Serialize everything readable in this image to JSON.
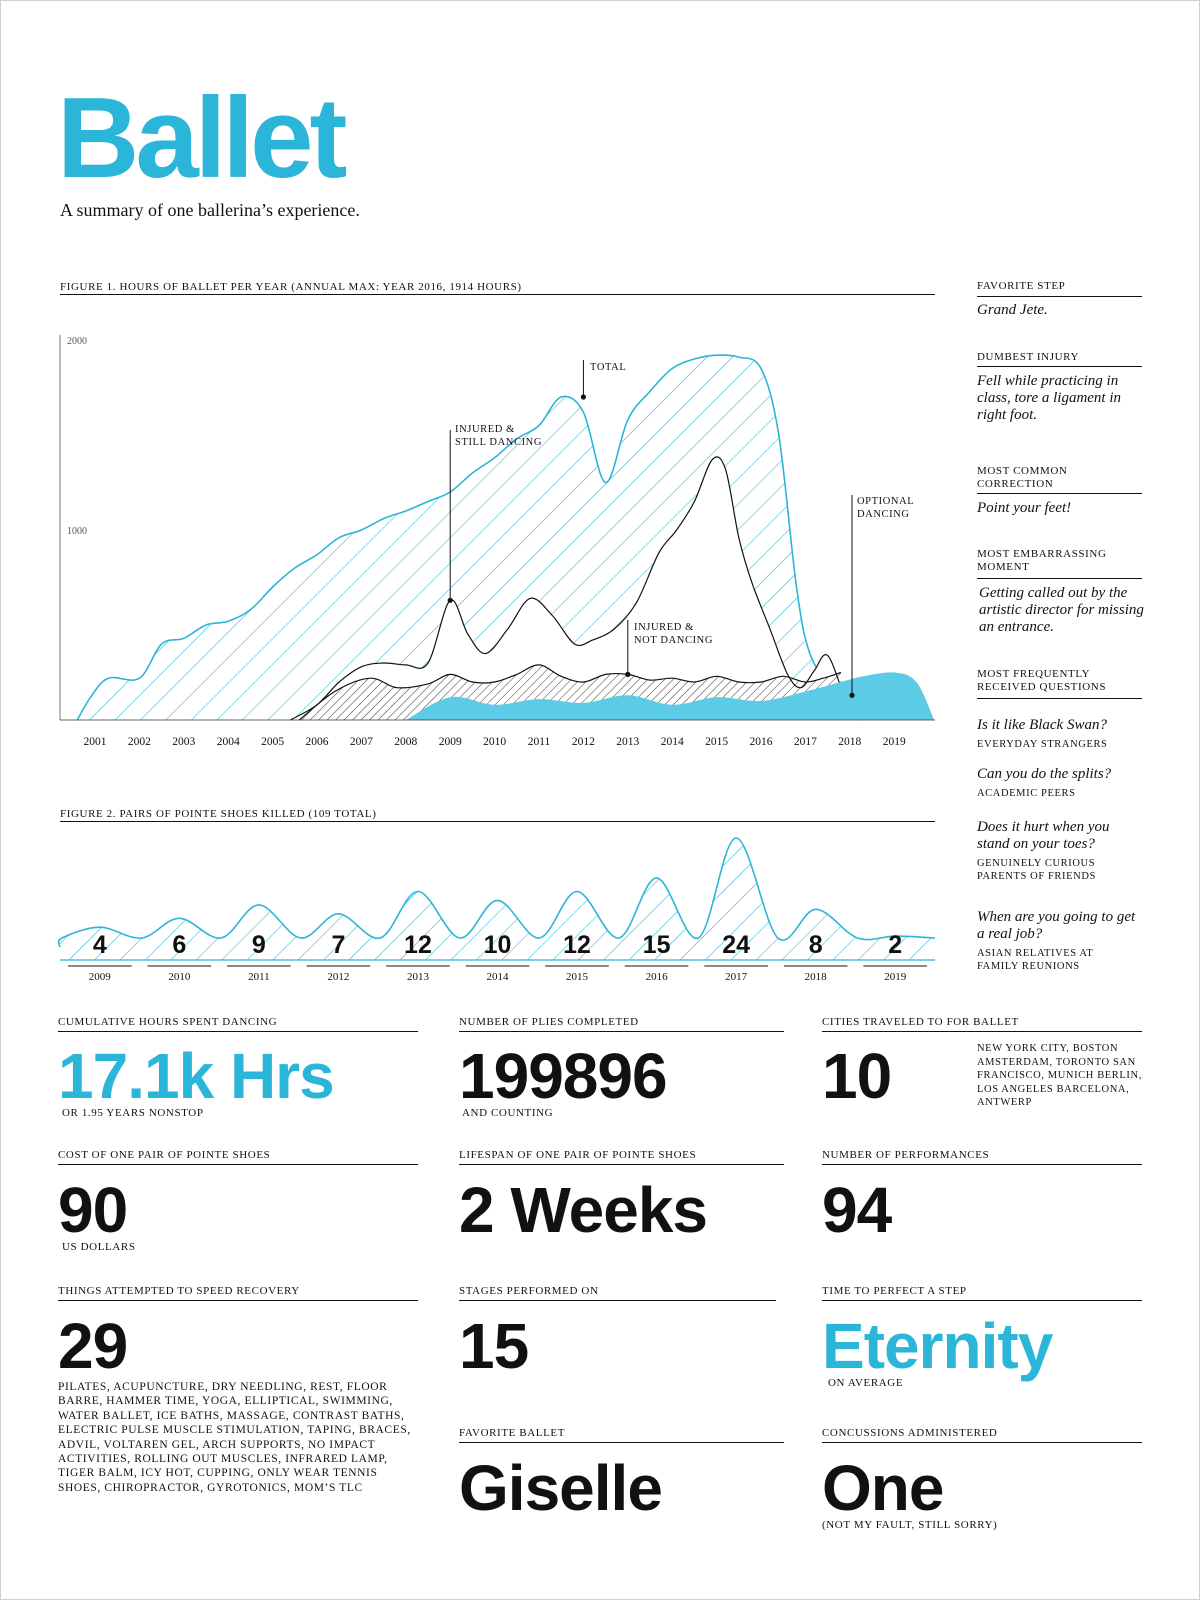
{
  "header": {
    "title": "Ballet",
    "subtitle": "A summary of one ballerina’s experience."
  },
  "colors": {
    "accent": "#2bb5d8",
    "fill_solid": "#5bcbe6",
    "text": "#111111"
  },
  "chart_data": [
    {
      "type": "area",
      "title": "Figure 1. Hours of ballet per year (annual max: year 2016, 1914 hours)",
      "ylim": [
        0,
        2000
      ],
      "y_ticks": [
        "2000",
        "1000"
      ],
      "x_ticks": [
        "2001",
        "2002",
        "2003",
        "2004",
        "2005",
        "2006",
        "2007",
        "2008",
        "2009",
        "2010",
        "2011",
        "2012",
        "2013",
        "2014",
        "2015",
        "2016",
        "2017",
        "2018",
        "2019"
      ],
      "series": [
        {
          "name": "Total",
          "x": [
            2000.6,
            2000.9,
            2001.3,
            2002,
            2002.5,
            2003,
            2003.5,
            2004,
            2004.5,
            2005,
            2005.5,
            2006,
            2006.5,
            2007,
            2007.5,
            2008,
            2008.5,
            2009,
            2009.5,
            2010,
            2010.5,
            2011,
            2011.5,
            2012,
            2012.5,
            2013,
            2013.5,
            2014,
            2014.5,
            2015,
            2015.5,
            2016,
            2016.4,
            2016.8,
            2017.1,
            2017.6,
            2018
          ],
          "y": [
            0,
            120,
            220,
            220,
            400,
            430,
            500,
            520,
            580,
            700,
            800,
            870,
            960,
            1000,
            1060,
            1100,
            1150,
            1200,
            1300,
            1380,
            1480,
            1550,
            1700,
            1620,
            1250,
            1580,
            1730,
            1850,
            1900,
            1920,
            1910,
            1850,
            1500,
            700,
            350,
            170,
            130
          ]
        },
        {
          "name": "Injured & still dancing",
          "x": [
            2005.4,
            2006,
            2006.5,
            2007,
            2007.5,
            2008,
            2008.5,
            2009,
            2009.4,
            2009.8,
            2010.3,
            2010.8,
            2011.3,
            2011.8,
            2012.2,
            2012.7,
            2013.2,
            2013.7,
            2014.1,
            2014.5,
            2014.9,
            2015.2,
            2015.5,
            2015.8,
            2016.2,
            2016.6,
            2016.9,
            2017.2,
            2017.5,
            2017.9,
            2018.3
          ],
          "y": [
            0,
            80,
            200,
            280,
            300,
            290,
            300,
            630,
            450,
            350,
            480,
            640,
            550,
            400,
            420,
            480,
            620,
            880,
            1000,
            1150,
            1370,
            1320,
            960,
            720,
            480,
            240,
            170,
            260,
            340,
            120,
            0
          ]
        },
        {
          "name": "Injured & not dancing",
          "x": [
            2005.6,
            2006.4,
            2007.2,
            2007.8,
            2008.5,
            2009,
            2009.5,
            2010,
            2010.5,
            2011,
            2011.5,
            2012,
            2012.5,
            2013,
            2013.5,
            2014,
            2014.5,
            2015,
            2015.5,
            2016,
            2016.5,
            2017,
            2017.4,
            2017.8
          ],
          "y": [
            0,
            150,
            220,
            170,
            190,
            240,
            200,
            200,
            240,
            290,
            230,
            200,
            240,
            240,
            210,
            220,
            200,
            230,
            200,
            200,
            230,
            200,
            220,
            250
          ]
        },
        {
          "name": "Optional dancing",
          "x": [
            2008,
            2009,
            2010,
            2011,
            2012,
            2013,
            2014,
            2015,
            2016,
            2017,
            2017.8,
            2018.3,
            2019,
            2019.5,
            2019.9
          ],
          "y": [
            0,
            120,
            80,
            110,
            90,
            130,
            80,
            120,
            100,
            150,
            200,
            230,
            250,
            200,
            0
          ]
        }
      ],
      "annotations": [
        "Injured & still dancing",
        "Total",
        "Injured & not dancing",
        "Optional dancing"
      ]
    },
    {
      "type": "area",
      "title": "Figure 2. Pairs of pointe shoes killed (109 total)",
      "categories": [
        "2009",
        "2010",
        "2011",
        "2012",
        "2013",
        "2014",
        "2015",
        "2016",
        "2017",
        "2018",
        "2019"
      ],
      "values": [
        4,
        6,
        9,
        7,
        12,
        10,
        12,
        15,
        24,
        8,
        2
      ]
    }
  ],
  "sidebar": {
    "favorite_step_label": "Favorite step",
    "favorite_step": "Grand Jete.",
    "dumbest_injury_label": "Dumbest injury",
    "dumbest_injury": "Fell while practicing in class, tore a ligament in right foot.",
    "most_common_correction_label": "Most common correction",
    "most_common_correction": "Point your feet!",
    "most_embarrassing_label": "Most embarrassing moment",
    "most_embarrassing": "Getting called out by the artistic director for missing an entrance.",
    "questions_label": "Most frequently received questions",
    "questions": [
      {
        "q": "Is it like Black Swan?",
        "who": "Everyday strangers"
      },
      {
        "q": "Can you do the splits?",
        "who": "Academic peers"
      },
      {
        "q": "Does it hurt when you stand on your toes?",
        "who": "Genuinely curious parents of friends"
      },
      {
        "q": "When are you going to get a real job?",
        "who": "Asian relatives at family reunions"
      }
    ]
  },
  "stats": {
    "cumulative": {
      "label": "Cumulative hours spent dancing",
      "value": "17.1k Hrs",
      "note": "or 1.95 years nonstop"
    },
    "plies": {
      "label": "Number of plies completed",
      "value": "199896",
      "note": "and counting"
    },
    "cities": {
      "label": "Cities traveled to for ballet",
      "value": "10",
      "note": "New York City, Boston Amsterdam, Toronto San Francisco, Munich Berlin, Los Angeles Barcelona, Antwerp"
    },
    "cost": {
      "label": "Cost of one pair of pointe shoes",
      "value": "90",
      "note": "US dollars"
    },
    "lifespan": {
      "label": "Lifespan of one pair of pointe shoes",
      "value": "2 Weeks"
    },
    "performances": {
      "label": "Number of performances",
      "value": "94"
    },
    "recovery": {
      "label": "Things attempted to speed recovery",
      "value": "29",
      "note": "Pilates, acupuncture, dry needling, rest, floor barre, hammer time, yoga, elliptical, swimming, water ballet, ice baths, massage, contrast baths, electric pulse muscle stimulation, taping, braces, Advil, Voltaren gel, arch supports, no impact activities, rolling out muscles, infrared lamp, tiger balm, icy hot, cupping, only wear tennis shoes, chiropractor, gyrotonics, Mom’s TLC"
    },
    "stages": {
      "label": "Stages performed on",
      "value": "15"
    },
    "perfect": {
      "label": "Time to perfect a step",
      "value": "Eternity",
      "note": "on average"
    },
    "favorite_ballet": {
      "label": "Favorite ballet",
      "value": "Giselle"
    },
    "concussions": {
      "label": "Concussions administered",
      "value": "One",
      "note": "(not my fault, still sorry)"
    }
  }
}
